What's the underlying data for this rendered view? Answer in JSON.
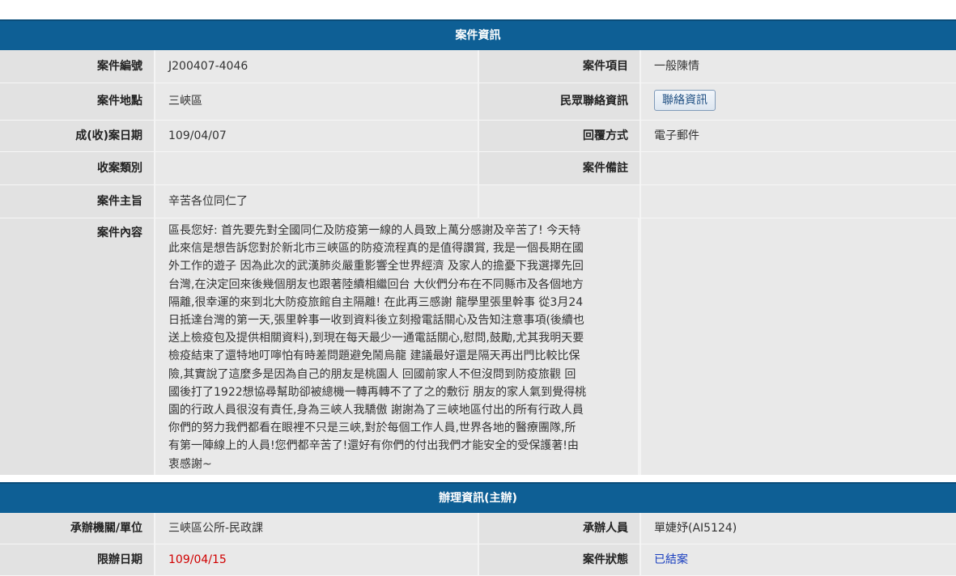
{
  "case_info": {
    "header": "案件資訊",
    "fields": {
      "case_no_label": "案件編號",
      "case_no": "J200407-4046",
      "case_item_label": "案件項目",
      "case_item": "一般陳情",
      "location_label": "案件地點",
      "location": "三峽區",
      "contact_label": "民眾聯絡資訊",
      "contact_button": "聯絡資訊",
      "date_label": "成(收)案日期",
      "date": "109/04/07",
      "reply_label": "回覆方式",
      "reply": "電子郵件",
      "category_label": "收案類別",
      "category": "",
      "remark_label": "案件備註",
      "remark": "",
      "subject_label": "案件主旨",
      "subject": "辛苦各位同仁了",
      "content_label": "案件內容",
      "content_lines": [
        "區長您好: 首先要先對全國同仁及防疫第一線的人員致上萬分感謝及辛苦了! 今天特",
        "此來信是想告訴您對於新北市三峽區的防疫流程真的是值得讚賞, 我是一個長期在國",
        "外工作的遊子 因為此次的武漢肺炎嚴重影響全世界經濟 及家人的擔憂下我選擇先回",
        "台灣,在決定回來後幾個朋友也跟著陸續相繼回台 大伙們分布在不同縣市及各個地方",
        "隔離,很幸運的來到北大防疫旅館自主隔離! 在此再三感謝 龍學里張里幹事 從3月24",
        "日抵達台灣的第一天,張里幹事一收到資料後立刻撥電話關心及告知注意事項(後續也",
        "送上檢疫包及提供相關資料),到現在每天最少一通電話關心,慰問,鼓勵,尤其我明天要",
        "檢疫結束了還特地叮嚀怕有時差問題避免鬧烏龍 建議最好還是隔天再出門比較比保",
        "險,其實說了這麼多是因為自己的朋友是桃園人 回國前家人不但沒問到防疫旅觀 回",
        "國後打了1922想協尋幫助卻被總機一轉再轉不了了之的敷衍 朋友的家人氣到覺得桃",
        "園的行政人員很沒有責任,身為三峽人我驕傲 謝謝為了三峽地區付出的所有行政人員",
        "你們的努力我們都看在眼裡不只是三峽,對於每個工作人員,世界各地的醫療團隊,所",
        "有第一陣線上的人員!您們都辛苦了!還好有你們的付出我們才能安全的受保護著!由",
        "衷感謝~"
      ]
    }
  },
  "handling_info": {
    "header": "辦理資訊(主辦)",
    "fields": {
      "agency_label": "承辦機關/單位",
      "agency": "三峽區公所-民政課",
      "officer_label": "承辦人員",
      "officer": "單婕妤(AI5124)",
      "deadline_label": "限辦日期",
      "deadline": "109/04/15",
      "status_label": "案件狀態",
      "status": "已結案"
    }
  },
  "colors": {
    "header_bg": "#0e5f95",
    "deadline_text": "#d00000",
    "status_text": "#1a3fbf"
  }
}
